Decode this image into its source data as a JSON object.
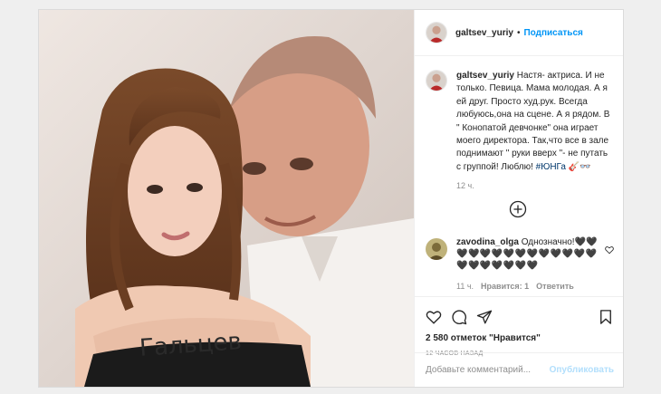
{
  "post": {
    "author": "galtsev_yuriy",
    "separator": "•",
    "follow_label": "Подписаться",
    "photo_text": "Гальцев",
    "caption": {
      "username": "galtsev_yuriy",
      "text": "Настя- актриса. И не только. Певица. Мама молодая. А я ей друг. Просто худ.рук. Всегда любуюсь,она на сцене. А я рядом. В \" Конопатой девчонке\" она играет моего директора. Так,что все в зале поднимают \" руки вверх \"- не путать с группой! Люблю! ",
      "hashtag": "#ЮНГа",
      "emoji": "🎸👓",
      "time": "12 ч."
    },
    "comment": {
      "username": "zavodina_olga",
      "text": "Однозначно!🖤🖤",
      "hearts": "🖤🖤🖤🖤🖤🖤🖤🖤🖤🖤🖤🖤🖤🖤🖤🖤🖤🖤🖤",
      "time": "11 ч.",
      "likes": "Нравится: 1",
      "reply": "Ответить"
    },
    "likes": "2 580 отметок \"Нравится\"",
    "posted": "12 часов назад",
    "add_comment_placeholder": "Добавьте комментарий...",
    "publish_label": "Опубликовать"
  },
  "icons": {
    "like": "heart-icon",
    "comment": "comment-icon",
    "share": "share-icon",
    "save": "bookmark-icon",
    "more": "plus-circle-icon"
  },
  "colors": {
    "link": "#0095f6",
    "muted": "#8e8e8e",
    "border": "#dbdbdb"
  }
}
